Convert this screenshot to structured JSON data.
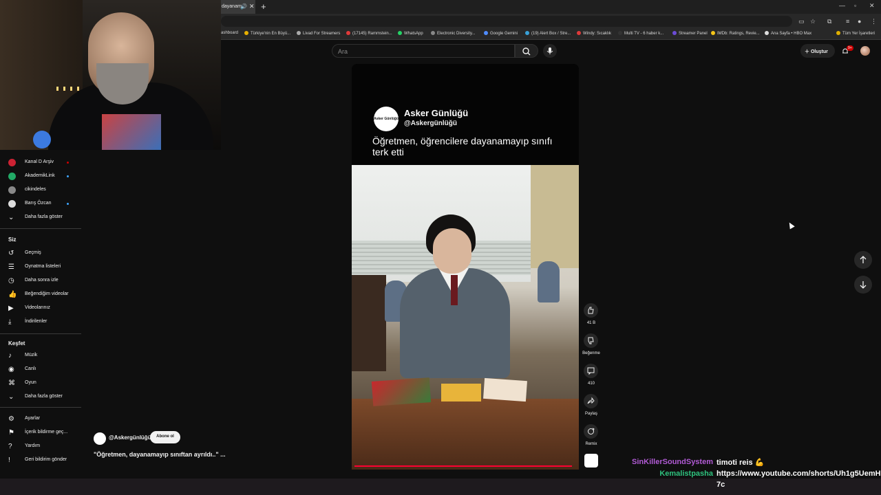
{
  "browser": {
    "active_tab_title": "dayanam",
    "bookmarks": [
      "ashboard",
      "Türkiye'nin En Büyü...",
      "Livad For Streamers",
      "(17145) Rammstein...",
      "WhatsApp",
      "Electronic Diversity...",
      "Google Gemini",
      "(19) Alert Box / Stre...",
      "Windy: Sıcaklık",
      "Multi TV - 6 haber k...",
      "Streamer Panel",
      "IMDb: Ratings, Revie...",
      "Ana Sayfa • HBO Max",
      "Tüm Yer İşaretleri"
    ]
  },
  "masthead": {
    "search_placeholder": "Ara",
    "create_label": "Oluştur",
    "notification_count": "9+"
  },
  "sidebar": {
    "subscriptions": [
      {
        "label": "Kanal D Arşiv",
        "dot_color": "#cc0000"
      },
      {
        "label": "AkademikLink",
        "dot_color": "#3ea6ff"
      },
      {
        "label": "cikindeles",
        "dot_color": ""
      },
      {
        "label": "Barış Özcan",
        "dot_color": "#3ea6ff"
      }
    ],
    "show_more": "Daha fazla göster",
    "you_heading": "Siz",
    "you_items": [
      "Geçmiş",
      "Oynatma listeleri",
      "Daha sonra izle",
      "Beğendiğim videolar",
      "Videolarınız",
      "İndirilenler"
    ],
    "explore_heading": "Keşfet",
    "explore_items": [
      "Müzik",
      "Canlı",
      "Oyun"
    ],
    "explore_more": "Daha fazla göster",
    "footer_items": [
      "Ayarlar",
      "İçerik bildirme geç...",
      "Yardım",
      "Geri bildirim gönder"
    ]
  },
  "short": {
    "overlay_channel": "Asker Günlüğü",
    "overlay_handle": "@Askergünlüğü",
    "overlay_caption": "Öğretmen, öğrencilere dayanamayıp sınıfı terk etti",
    "logo_text": "Asker Günlüğü",
    "channel_handle": "@Askergünlüğü",
    "subscribe_label": "Abone ol",
    "title": "\"Öğretmen, dayanamayıp sınıftan ayrıldı..\" ...",
    "actions": {
      "like_count": "41 B",
      "dislike_label": "Beğenme",
      "comment_count": "410",
      "share_label": "Paylaş",
      "remix_label": "Remix"
    },
    "progress": 0.98
  },
  "chat": [
    {
      "user": "SinKillerSoundSystem",
      "message": "timoti reis 💪",
      "user_color": "#b25bd6"
    },
    {
      "user": "Kemalistpasha",
      "message": "https://www.youtube.com/shorts/Uh1g5UemH",
      "user_color": "#2ec27e"
    }
  ],
  "chat_wrap": "7c"
}
